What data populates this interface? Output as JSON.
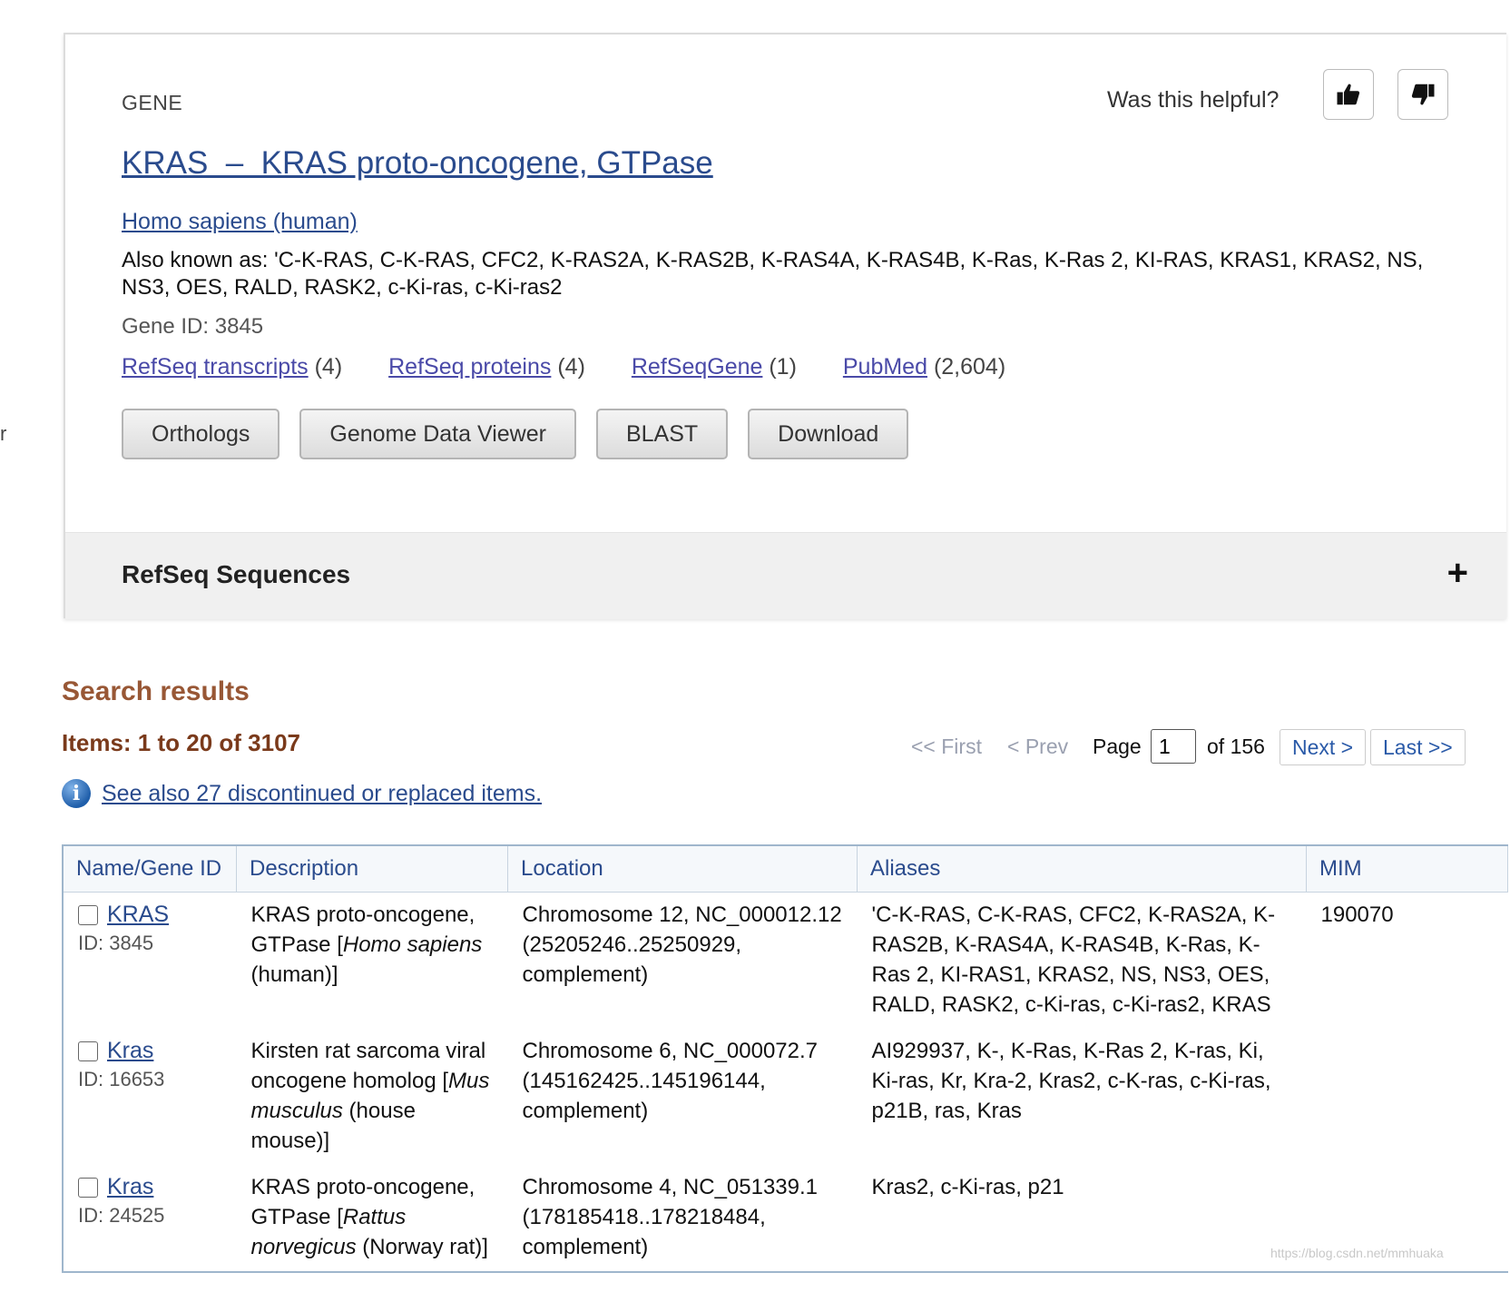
{
  "edge_text": "r",
  "gene_card": {
    "label": "GENE",
    "helpful_prompt": "Was this helpful?",
    "title": "KRAS  –  KRAS proto-oncogene, GTPase",
    "organism": "Homo sapiens (human)",
    "also_known_as": "Also known as: 'C-K-RAS, C-K-RAS, CFC2, K-RAS2A, K-RAS2B, K-RAS4A, K-RAS4B, K-Ras, K-Ras 2, KI-RAS, KRAS1, KRAS2, NS, NS3, OES, RALD, RASK2, c-Ki-ras, c-Ki-ras2",
    "gene_id": "Gene ID: 3845",
    "links": [
      {
        "label": "RefSeq transcripts",
        "count": "(4)"
      },
      {
        "label": "RefSeq proteins",
        "count": "(4)"
      },
      {
        "label": "RefSeqGene",
        "count": "(1)"
      },
      {
        "label": "PubMed",
        "count": "(2,604)"
      }
    ],
    "buttons": [
      "Orthologs",
      "Genome Data Viewer",
      "BLAST",
      "Download"
    ],
    "refseq_section": "RefSeq Sequences",
    "expand_symbol": "+"
  },
  "search_results": {
    "heading": "Search results",
    "items_count": "Items: 1 to 20 of 3107",
    "pager": {
      "first": "<< First",
      "prev": "< Prev",
      "page_label": "Page",
      "page_value": "1",
      "of_label": "of 156",
      "next": "Next >",
      "last": "Last >>"
    },
    "see_also": "See also 27 discontinued or replaced items.",
    "columns": [
      "Name/Gene ID",
      "Description",
      "Location",
      "Aliases",
      "MIM"
    ],
    "rows": [
      {
        "name": "KRAS",
        "id": "ID: 3845",
        "desc_pre": "KRAS proto-oncogene, GTPase [",
        "desc_species": "Homo sapiens",
        "desc_post": " (human)]",
        "location": "Chromosome 12, NC_000012.12 (25205246..25250929, complement)",
        "aliases": "'C-K-RAS, C-K-RAS, CFC2, K-RAS2A, K-RAS2B, K-RAS4A, K-RAS4B, K-Ras, K-Ras 2, KI-RAS1, KRAS2, NS, NS3, OES, RALD, RASK2, c-Ki-ras, c-Ki-ras2, KRAS",
        "mim": "190070"
      },
      {
        "name": "Kras",
        "id": "ID: 16653",
        "desc_pre": "Kirsten rat sarcoma viral oncogene homolog [",
        "desc_species": "Mus musculus",
        "desc_post": " (house mouse)]",
        "location": "Chromosome 6, NC_000072.7 (145162425..145196144, complement)",
        "aliases": "AI929937, K-, K-Ras, K-Ras 2, K-ras, Ki, Ki-ras, Kr, Kra-2, Kras2, c-K-ras, c-Ki-ras, p21B, ras, Kras",
        "mim": ""
      },
      {
        "name": "Kras",
        "id": "ID: 24525",
        "desc_pre": "KRAS proto-oncogene, GTPase [",
        "desc_species": "Rattus norvegicus",
        "desc_post": " (Norway rat)]",
        "location": "Chromosome 4, NC_051339.1 (178185418..178218484, complement)",
        "aliases": "Kras2, c-Ki-ras, p21",
        "mim": ""
      }
    ]
  },
  "watermark": "https://blog.csdn.net/mmhuaka"
}
